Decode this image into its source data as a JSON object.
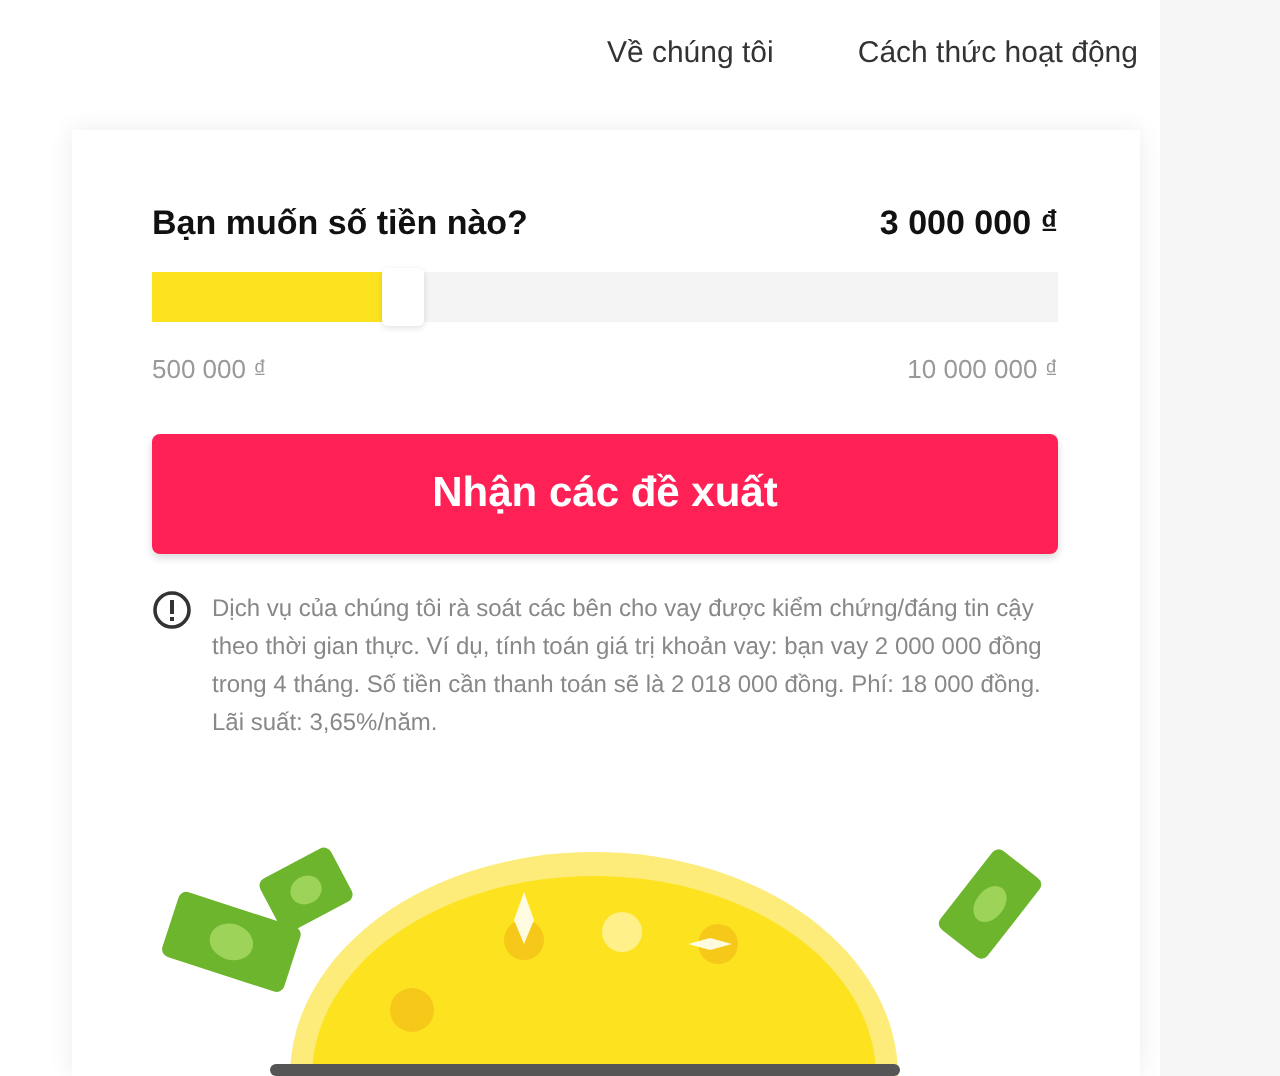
{
  "nav": [
    "Về chúng tôi",
    "Cách thức hoạt động"
  ],
  "amount": {
    "question": "Bạn muốn số tiền nào?",
    "value": "3 000 000 ₫",
    "level": 0.26,
    "min_label": "500 000 ₫",
    "max_label": "10 000 000 ₫"
  },
  "submit_button": "Nhận các đề xuất",
  "disclaimer": "Dịch vụ của chúng tôi rà soát các bên cho vay được kiểm chứng/đáng tin cậy theo thời gian thực. Ví dụ, tính toán giá trị khoản vay: bạn vay 2 000 000 đồng trong 4 tháng. Số tiền cần thanh toán sẽ là 2 018 000 đồng. Phí: 18 000 đồng. Lãi suất: 3,65%/năm."
}
